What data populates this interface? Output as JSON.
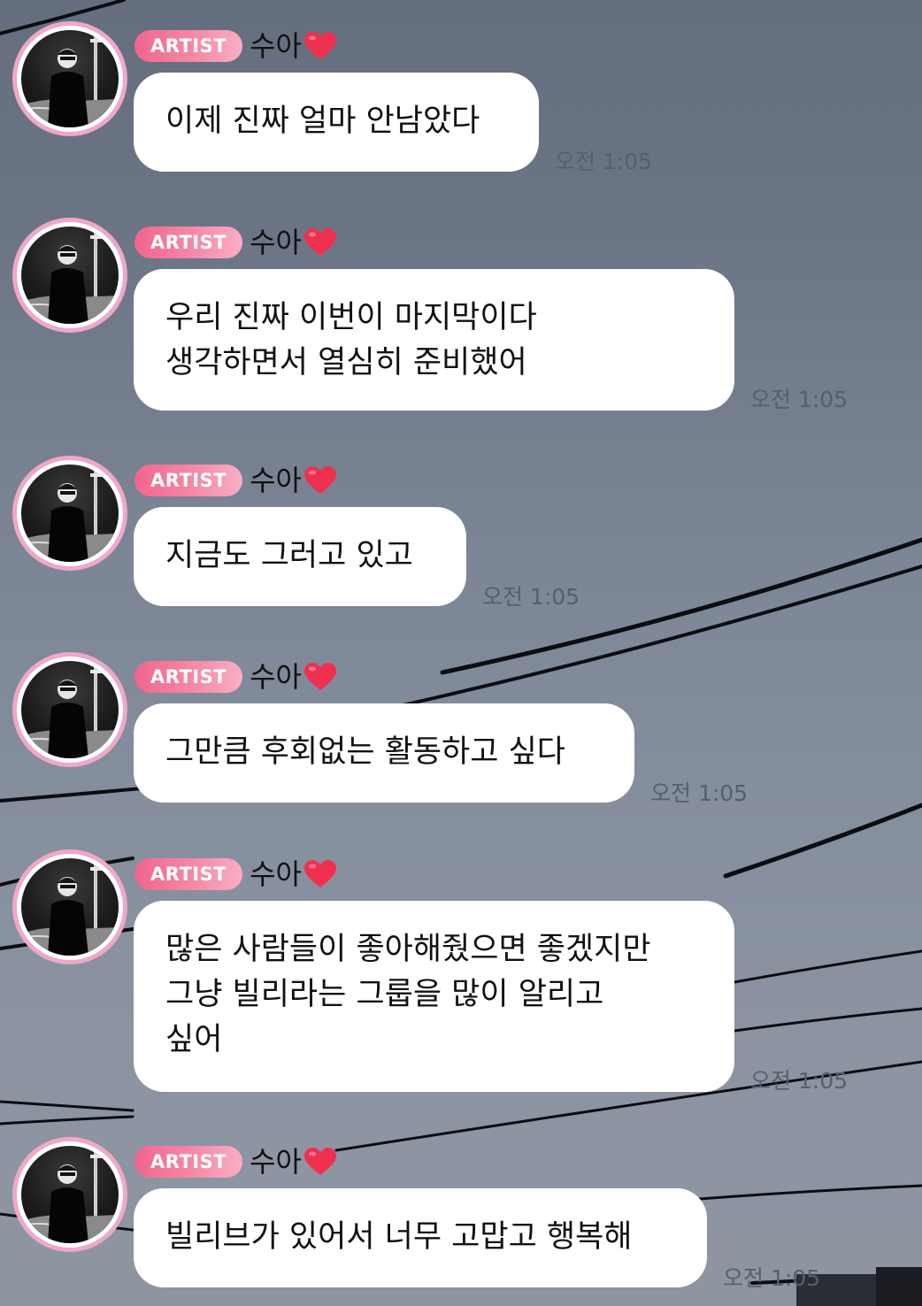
{
  "artist_badge": "ARTIST",
  "author_name": "수아",
  "heart_color": "#f0304f",
  "badge_color": "#f0668c",
  "messages": [
    {
      "text": "이제 진짜 얼마 안남았다",
      "time": "오전 1:05"
    },
    {
      "text": "우리 진짜 이번이 마지막이다\n생각하면서 열심히 준비했어",
      "time": "오전 1:05"
    },
    {
      "text": "지금도 그러고 있고",
      "time": "오전 1:05"
    },
    {
      "text": "그만큼 후회없는 활동하고 싶다",
      "time": "오전 1:05"
    },
    {
      "text": "많은 사람들이 좋아해줬으면 좋겠지만\n그냥 빌리라는 그룹을 많이 알리고\n싶어",
      "time": "오전 1:05"
    },
    {
      "text": "빌리브가 있어서 너무 고맙고 행복해",
      "time": "오전 1:05"
    }
  ]
}
